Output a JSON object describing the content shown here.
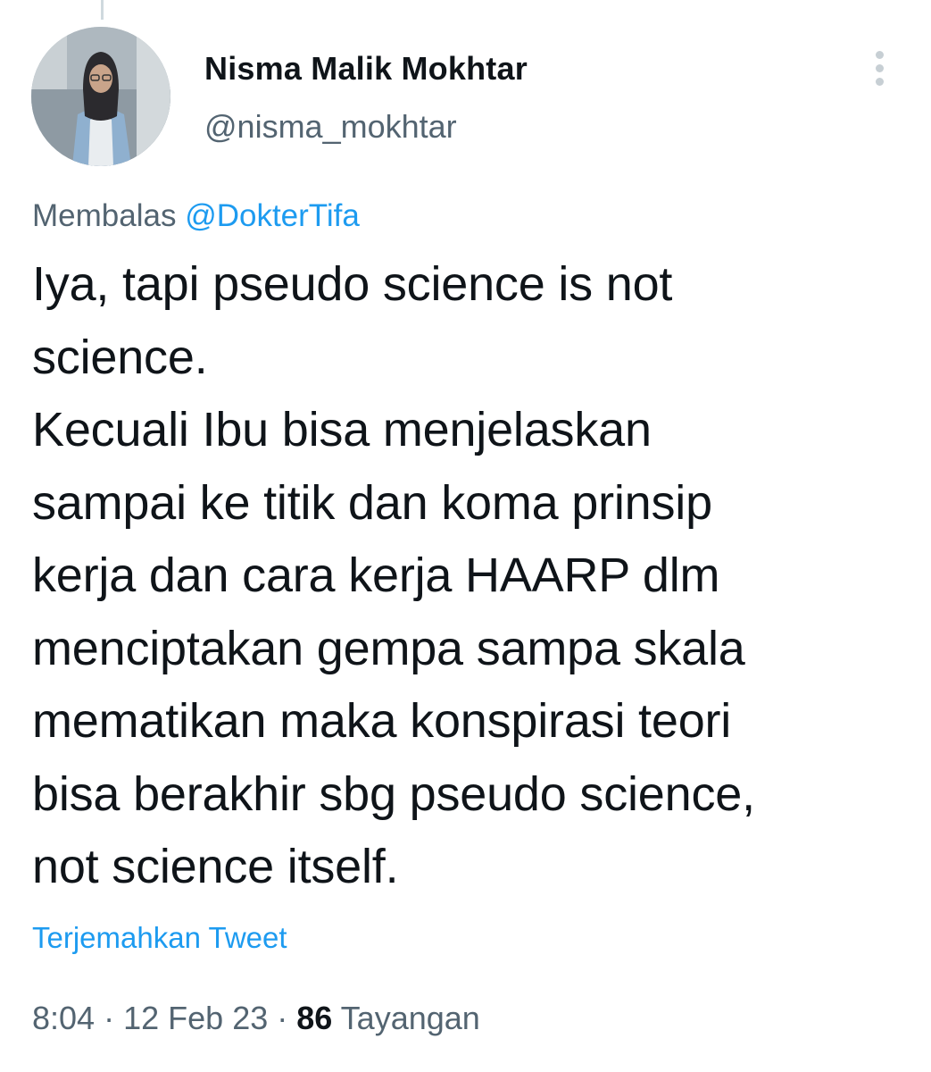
{
  "tweet": {
    "author": {
      "display_name": "Nisma Malik Mokhtar",
      "handle": "@nisma_mokhtar",
      "avatar_icon": "profile-photo"
    },
    "more_icon": "vertical-ellipsis-icon",
    "reply_prefix": "Membalas",
    "reply_to": "@DokterTifa",
    "text": "Iya, tapi pseudo science is not\nscience.\nKecuali Ibu bisa menjelaskan\nsampai ke titik dan koma prinsip\nkerja dan cara kerja HAARP dlm\nmenciptakan gempa sampa skala\nmematikan maka konspirasi teori\nbisa berakhir sbg pseudo science,\nnot science itself.",
    "translate_label": "Terjemahkan Tweet",
    "time": "8:04",
    "date": "12 Feb 23",
    "separator": "·",
    "views_count": "86",
    "views_label": "Tayangan"
  },
  "colors": {
    "text_primary": "#0f1419",
    "text_secondary": "#536471",
    "link": "#1d9bf0",
    "thread_line": "#cfd9de"
  }
}
